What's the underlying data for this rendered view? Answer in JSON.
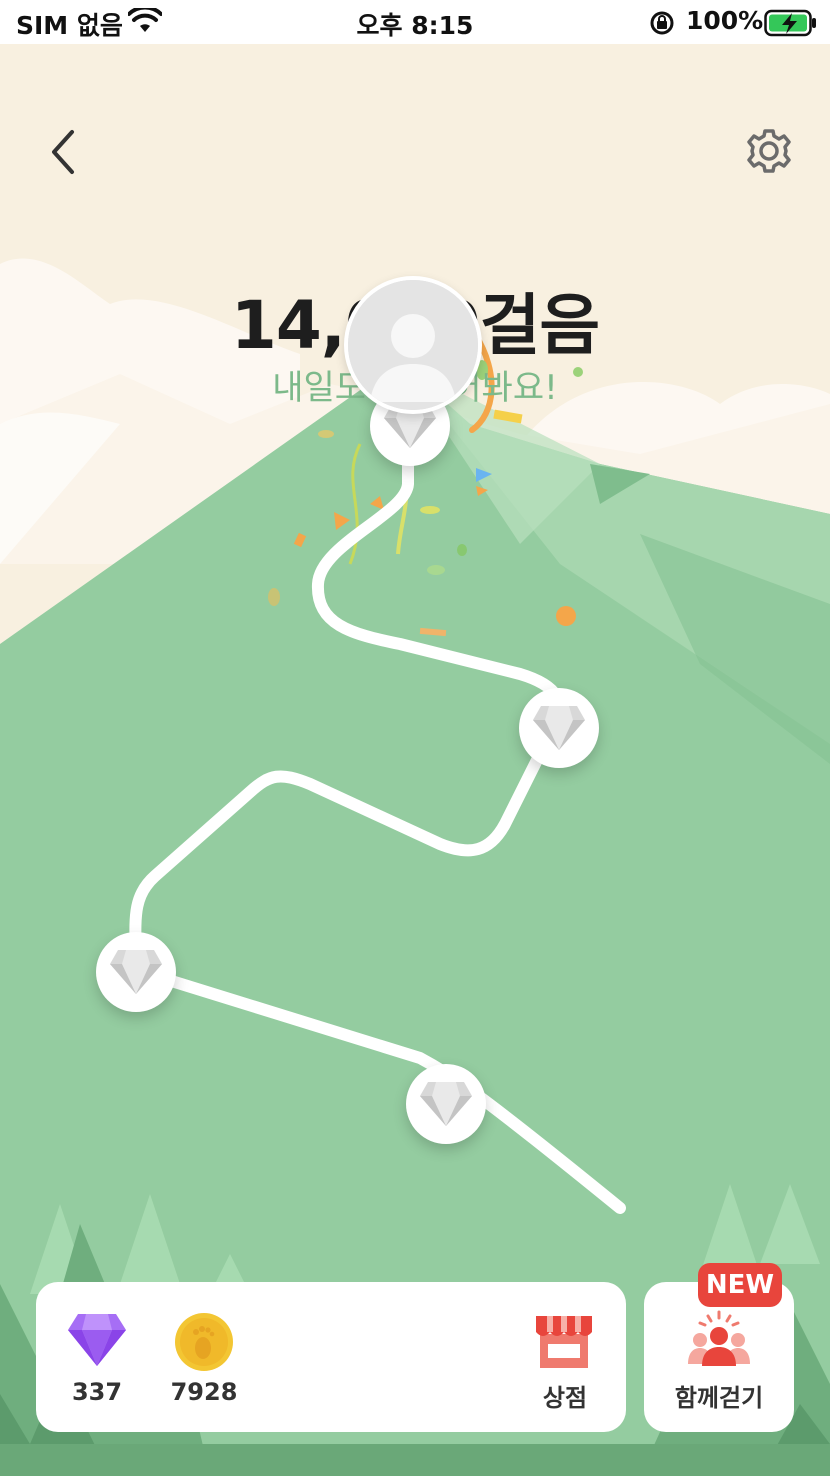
{
  "status_bar": {
    "carrier": "SIM 없음",
    "time": "오후 8:15",
    "battery": "100%"
  },
  "header": {
    "back_icon": "chevron-left-icon",
    "settings_icon": "gear-icon"
  },
  "progress": {
    "steps_text": "14,000걸음",
    "message": "내일도 더 걸어봐요!"
  },
  "path_nodes": [
    {
      "reward_icon": "diamond-icon"
    },
    {
      "reward_icon": "diamond-icon"
    },
    {
      "reward_icon": "diamond-icon"
    },
    {
      "reward_icon": "diamond-icon"
    }
  ],
  "wallet": {
    "gems": "337",
    "coins": "7928",
    "shop_label": "상점"
  },
  "walk_together": {
    "badge": "NEW",
    "label": "함께걷기"
  },
  "colors": {
    "mountain": "#94cca0",
    "path": "#ffffff",
    "accent_red": "#e8453c",
    "gem_purple": "#9b5cf0",
    "coin_gold": "#f3c633"
  }
}
